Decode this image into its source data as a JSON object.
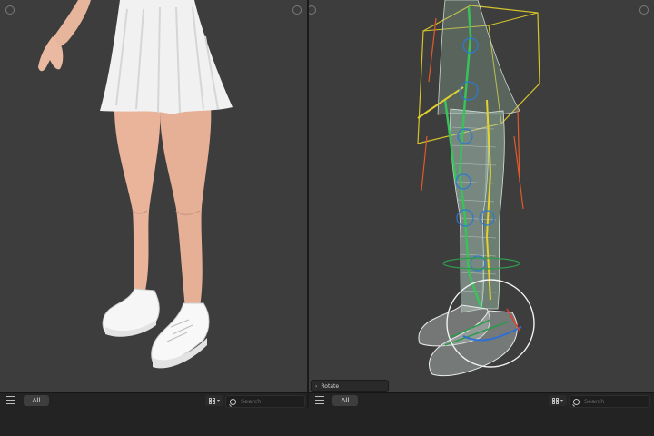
{
  "left_viewport": {
    "view_mode": "Rendered / Material Preview",
    "subject": "female-character-legs",
    "header": {
      "filter_tab_label": "All",
      "search_placeholder": "Search"
    }
  },
  "right_viewport": {
    "view_mode": "Wireframe with armature",
    "subject": "rigged-character-legs",
    "header": {
      "filter_tab_label": "All",
      "search_placeholder": "Search"
    }
  },
  "operator_panel": {
    "label": "Rotate"
  },
  "icons": {
    "menu": "hamburger-icon",
    "view_toggle": "grid-view-icon",
    "dropdown": "chevron-down-icon",
    "search": "search-icon",
    "panel_expand": "chevron-right-icon",
    "viewport_corner": "corner-widget-icon"
  },
  "colors": {
    "viewport_bg": "#3d3d3d",
    "bar_bg": "#232323",
    "skin": "#e8b8a0",
    "skirt": "#f3f3f3",
    "sneakers": "#f5f5f5",
    "bone_green": "#3ec45a",
    "bone_yellow": "#e6d330",
    "rotate_gizmo": "#ffffff"
  }
}
